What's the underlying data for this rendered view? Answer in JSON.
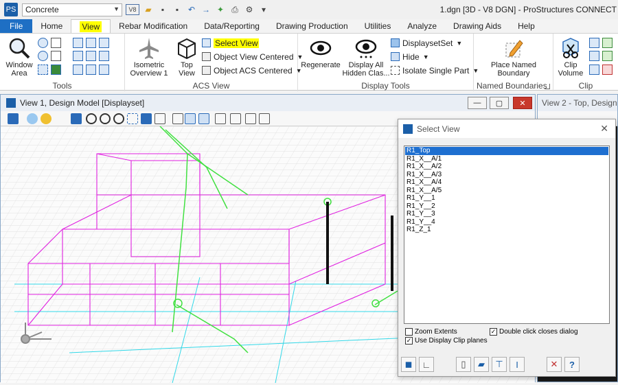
{
  "quick_access": {
    "app_icon": "PS",
    "workspace": "Concrete",
    "buttons": [
      "v8-icon",
      "open-icon",
      "save-icon",
      "save-as-icon",
      "undo-icon",
      "redo-icon",
      "pin-icon",
      "print-icon",
      "settings-icon",
      "more-icon"
    ]
  },
  "window_title": "1.dgn [3D - V8 DGN] - ProStructures CONNECT",
  "tabs": [
    {
      "label": "File"
    },
    {
      "label": "Home"
    },
    {
      "label": "View"
    },
    {
      "label": "Rebar Modification"
    },
    {
      "label": "Data/Reporting"
    },
    {
      "label": "Drawing Production"
    },
    {
      "label": "Utilities"
    },
    {
      "label": "Analyze"
    },
    {
      "label": "Drawing Aids"
    },
    {
      "label": "Help"
    }
  ],
  "ribbon": {
    "tools": {
      "label": "Tools",
      "window_area": "Window Area"
    },
    "acs_view": {
      "label": "ACS View",
      "isometric": "Isometric Overview 1",
      "top_view": "Top View",
      "select_view": "Select View",
      "object_view_centered": "Object View Centered",
      "object_acs_centered": "Object ACS Centered"
    },
    "display_tools": {
      "label": "Display Tools",
      "regenerate": "Regenerate",
      "display_all_hidden": "Display All Hidden Clas...",
      "displayset_set": "DisplaysetSet",
      "hide": "Hide",
      "isolate_single_part": "Isolate Single Part"
    },
    "named_boundaries": {
      "label": "Named Boundaries",
      "place": "Place Named Boundary"
    },
    "clip": {
      "label": "Clip",
      "clip_volume": "Clip Volume"
    }
  },
  "view1": {
    "title": "View 1, Design Model [Displayset]"
  },
  "view2": {
    "title": "View 2 - Top, Design"
  },
  "dialog": {
    "title": "Select View",
    "items": [
      "R1_Top",
      "R1_X__A/1",
      "R1_X__A/2",
      "R1_X__A/3",
      "R1_X__A/4",
      "R1_X__A/5",
      "R1_Y__1",
      "R1_Y__2",
      "R1_Y__3",
      "R1_Y__4",
      "R1_Z_1"
    ],
    "selected": "R1_Top",
    "zoom_extents": {
      "label": "Zoom Extents",
      "checked": false
    },
    "double_click_closes": {
      "label": "Double click closes dialog",
      "checked": true
    },
    "use_display_clip": {
      "label": "Use Display Clip planes",
      "checked": true
    }
  },
  "colors": {
    "accent": "#1e6fc4",
    "highlight": "#ffff00",
    "wire_magenta": "#e020e0",
    "wire_green": "#40e040",
    "wire_cyan": "#30d8e8"
  }
}
